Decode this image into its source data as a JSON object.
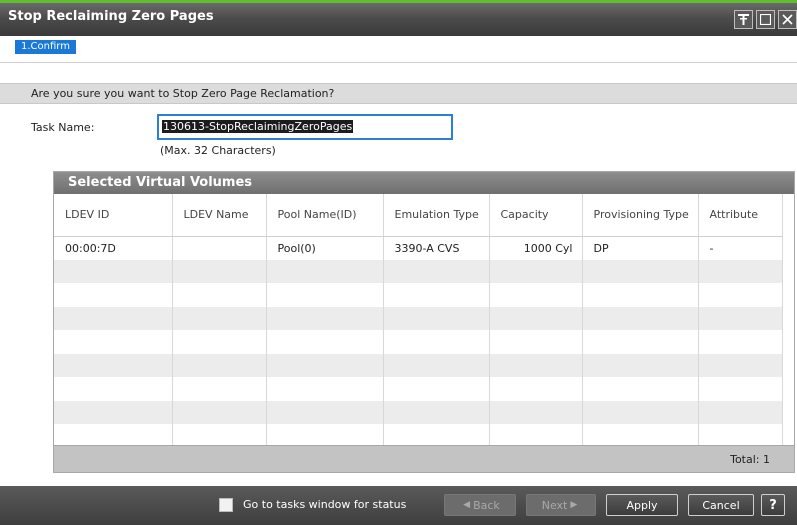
{
  "window": {
    "title": "Stop Reclaiming Zero Pages",
    "controls": [
      "pin-icon",
      "maximize-icon",
      "close-icon"
    ]
  },
  "steps": [
    {
      "label": "1.Confirm",
      "active": true
    }
  ],
  "question": "Are you sure you want to Stop Zero Page Reclamation?",
  "task": {
    "label": "Task Name:",
    "value": "130613-StopReclaimingZeroPages",
    "hint": "(Max. 32 Characters)"
  },
  "volumes": {
    "title": "Selected Virtual Volumes",
    "columns": [
      "LDEV ID",
      "LDEV Name",
      "Pool Name(ID)",
      "Emulation Type",
      "Capacity",
      "Provisioning Type",
      "Attribute"
    ],
    "rows": [
      [
        "00:00:7D",
        "",
        "Pool(0)",
        "3390-A CVS",
        "1000 Cyl",
        "DP",
        "-"
      ]
    ],
    "empty_rows": 8,
    "total_label": "Total:",
    "total_value": "1"
  },
  "footer": {
    "checkbox_label": "Go to tasks window for status",
    "checkbox_checked": false,
    "back_label": "Back",
    "next_label": "Next",
    "apply_label": "Apply",
    "cancel_label": "Cancel",
    "help_label": "?"
  },
  "colors": {
    "accent_green": "#5fbf2e",
    "step_blue": "#1a78d6",
    "focus_blue": "#2b7fd4"
  }
}
